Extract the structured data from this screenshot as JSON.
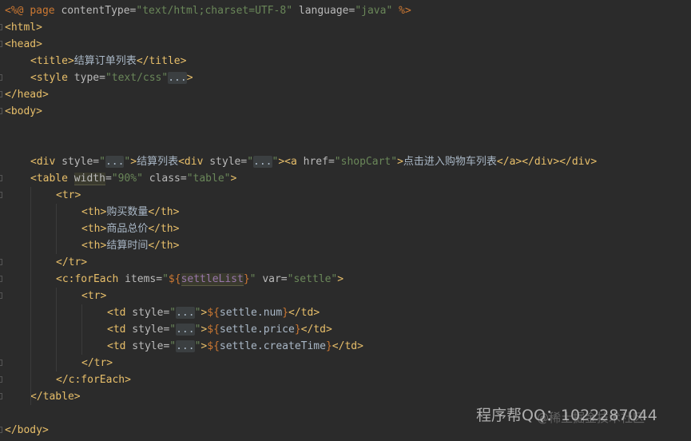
{
  "editor": {
    "lines": [
      {
        "indent": 0,
        "tokens": [
          {
            "t": "<%@ ",
            "c": "dir"
          },
          {
            "t": "page",
            "c": "dirkw"
          },
          {
            "t": " contentType=",
            "c": "attr"
          },
          {
            "t": "\"text/html;charset=UTF-8\"",
            "c": "str"
          },
          {
            "t": " language=",
            "c": "attr"
          },
          {
            "t": "\"java\"",
            "c": "str"
          },
          {
            "t": " %>",
            "c": "dir"
          }
        ]
      },
      {
        "indent": 0,
        "fold": true,
        "tokens": [
          {
            "t": "<html>",
            "c": "tag"
          }
        ]
      },
      {
        "indent": 0,
        "fold": true,
        "tokens": [
          {
            "t": "<head>",
            "c": "tag"
          }
        ]
      },
      {
        "indent": 1,
        "tokens": [
          {
            "t": "<title>",
            "c": "tag"
          },
          {
            "t": "结算订单列表",
            "c": "txt"
          },
          {
            "t": "</title>",
            "c": "tag"
          }
        ]
      },
      {
        "indent": 1,
        "fold": true,
        "tokens": [
          {
            "t": "<style",
            "c": "tag"
          },
          {
            "t": " type=",
            "c": "attr"
          },
          {
            "t": "\"text/css\"",
            "c": "str"
          },
          {
            "t": "...",
            "c": "folded"
          },
          {
            "t": ">",
            "c": "tag"
          }
        ]
      },
      {
        "indent": 0,
        "fold": true,
        "tokens": [
          {
            "t": "</head>",
            "c": "tag"
          }
        ]
      },
      {
        "indent": 0,
        "fold": true,
        "tokens": [
          {
            "t": "<body>",
            "c": "tag"
          }
        ]
      },
      {
        "indent": 0,
        "tokens": []
      },
      {
        "indent": 0,
        "tokens": []
      },
      {
        "indent": 1,
        "tokens": [
          {
            "t": "<div",
            "c": "tag"
          },
          {
            "t": " style=",
            "c": "attr"
          },
          {
            "t": "\"",
            "c": "str"
          },
          {
            "t": "...",
            "c": "folded"
          },
          {
            "t": "\"",
            "c": "str"
          },
          {
            "t": ">",
            "c": "tag"
          },
          {
            "t": "结算列表",
            "c": "txt"
          },
          {
            "t": "<div",
            "c": "tag"
          },
          {
            "t": " style=",
            "c": "attr"
          },
          {
            "t": "\"",
            "c": "str"
          },
          {
            "t": "...",
            "c": "folded"
          },
          {
            "t": "\"",
            "c": "str"
          },
          {
            "t": "><a",
            "c": "tag"
          },
          {
            "t": " href=",
            "c": "attr"
          },
          {
            "t": "\"shopCart\"",
            "c": "str"
          },
          {
            "t": ">",
            "c": "tag"
          },
          {
            "t": "点击进入购物车列表",
            "c": "txt"
          },
          {
            "t": "</a></div></div>",
            "c": "tag"
          }
        ]
      },
      {
        "indent": 1,
        "fold": true,
        "tokens": [
          {
            "t": "<table",
            "c": "tag"
          },
          {
            "t": " ",
            "c": "attr"
          },
          {
            "t": "width",
            "c": "attr",
            "hl": true
          },
          {
            "t": "=",
            "c": "attr"
          },
          {
            "t": "\"90%\"",
            "c": "str"
          },
          {
            "t": " class=",
            "c": "attr"
          },
          {
            "t": "\"table\"",
            "c": "str"
          },
          {
            "t": ">",
            "c": "tag"
          }
        ]
      },
      {
        "indent": 2,
        "fold": true,
        "tokens": [
          {
            "t": "<tr>",
            "c": "tag"
          }
        ]
      },
      {
        "indent": 3,
        "tokens": [
          {
            "t": "<th>",
            "c": "tag"
          },
          {
            "t": "购买数量",
            "c": "txt"
          },
          {
            "t": "</th>",
            "c": "tag"
          }
        ]
      },
      {
        "indent": 3,
        "tokens": [
          {
            "t": "<th>",
            "c": "tag"
          },
          {
            "t": "商品总价",
            "c": "txt"
          },
          {
            "t": "</th>",
            "c": "tag"
          }
        ]
      },
      {
        "indent": 3,
        "tokens": [
          {
            "t": "<th>",
            "c": "tag"
          },
          {
            "t": "结算时间",
            "c": "txt"
          },
          {
            "t": "</th>",
            "c": "tag"
          }
        ]
      },
      {
        "indent": 2,
        "fold": true,
        "tokens": [
          {
            "t": "</tr>",
            "c": "tag"
          }
        ]
      },
      {
        "indent": 2,
        "fold": true,
        "tokens": [
          {
            "t": "<c:forEach",
            "c": "tag"
          },
          {
            "t": " items=",
            "c": "attr"
          },
          {
            "t": "\"",
            "c": "str"
          },
          {
            "t": "${",
            "c": "dir"
          },
          {
            "t": "settleList",
            "c": "elvar",
            "hl": true
          },
          {
            "t": "}",
            "c": "dir"
          },
          {
            "t": "\"",
            "c": "str"
          },
          {
            "t": " var=",
            "c": "attr"
          },
          {
            "t": "\"settle\"",
            "c": "str"
          },
          {
            "t": ">",
            "c": "tag"
          }
        ]
      },
      {
        "indent": 3,
        "fold": true,
        "tokens": [
          {
            "t": "<tr>",
            "c": "tag"
          }
        ]
      },
      {
        "indent": 4,
        "tokens": [
          {
            "t": "<td",
            "c": "tag"
          },
          {
            "t": " style=",
            "c": "attr"
          },
          {
            "t": "\"",
            "c": "str"
          },
          {
            "t": "...",
            "c": "folded"
          },
          {
            "t": "\"",
            "c": "str"
          },
          {
            "t": ">",
            "c": "tag"
          },
          {
            "t": "${",
            "c": "dir"
          },
          {
            "t": "settle.num",
            "c": "txt"
          },
          {
            "t": "}",
            "c": "dir"
          },
          {
            "t": "</td>",
            "c": "tag"
          }
        ]
      },
      {
        "indent": 4,
        "tokens": [
          {
            "t": "<td",
            "c": "tag"
          },
          {
            "t": " style=",
            "c": "attr"
          },
          {
            "t": "\"",
            "c": "str"
          },
          {
            "t": "...",
            "c": "folded"
          },
          {
            "t": "\"",
            "c": "str"
          },
          {
            "t": ">",
            "c": "tag"
          },
          {
            "t": "${",
            "c": "dir"
          },
          {
            "t": "settle.price",
            "c": "txt"
          },
          {
            "t": "}",
            "c": "dir"
          },
          {
            "t": "</td>",
            "c": "tag"
          }
        ]
      },
      {
        "indent": 4,
        "tokens": [
          {
            "t": "<td",
            "c": "tag"
          },
          {
            "t": " style=",
            "c": "attr"
          },
          {
            "t": "\"",
            "c": "str"
          },
          {
            "t": "...",
            "c": "folded"
          },
          {
            "t": "\"",
            "c": "str"
          },
          {
            "t": ">",
            "c": "tag"
          },
          {
            "t": "${",
            "c": "dir"
          },
          {
            "t": "settle.createTime",
            "c": "txt"
          },
          {
            "t": "}",
            "c": "dir"
          },
          {
            "t": "</td>",
            "c": "tag"
          }
        ]
      },
      {
        "indent": 3,
        "fold": true,
        "tokens": [
          {
            "t": "</tr>",
            "c": "tag"
          }
        ]
      },
      {
        "indent": 2,
        "fold": true,
        "tokens": [
          {
            "t": "</c:forEach>",
            "c": "tag"
          }
        ]
      },
      {
        "indent": 1,
        "fold": true,
        "tokens": [
          {
            "t": "</table>",
            "c": "tag"
          }
        ]
      },
      {
        "indent": 0,
        "tokens": []
      },
      {
        "indent": 0,
        "fold": true,
        "tokens": [
          {
            "t": "</body>",
            "c": "tag"
          }
        ]
      }
    ]
  },
  "watermark": {
    "main": "程序帮QQ：1022287044",
    "faint": "@稀土掘金技术社区"
  }
}
